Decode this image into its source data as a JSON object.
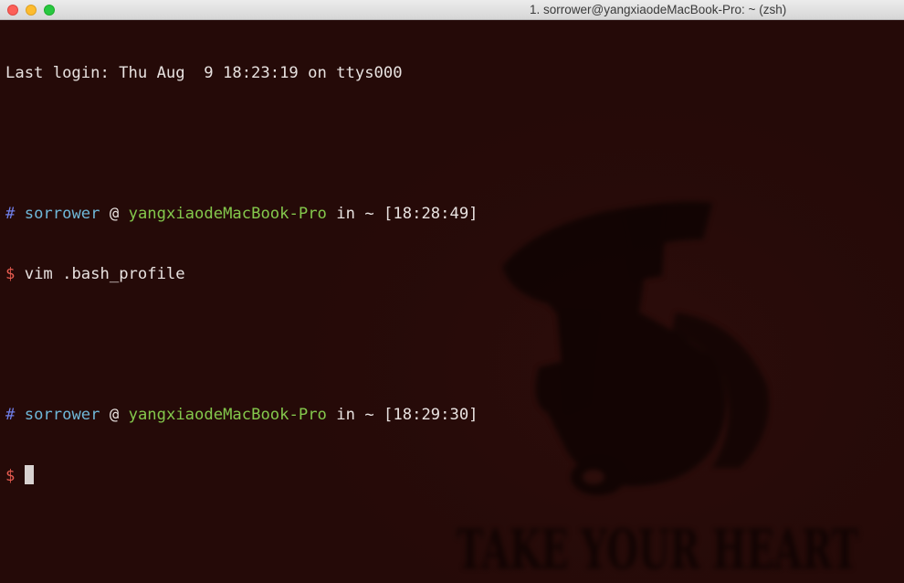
{
  "window": {
    "title": "1. sorrower@yangxiaodeMacBook-Pro: ~ (zsh)"
  },
  "terminal": {
    "last_login": "Last login: Thu Aug  9 18:23:19 on ttys000",
    "prompts": [
      {
        "hash": "#",
        "user": "sorrower",
        "at": "@",
        "host": "yangxiaodeMacBook-Pro",
        "in": "in",
        "dir": "~",
        "time": "[18:28:49]",
        "dollar": "$",
        "command": "vim .bash_profile"
      },
      {
        "hash": "#",
        "user": "sorrower",
        "at": "@",
        "host": "yangxiaodeMacBook-Pro",
        "in": "in",
        "dir": "~",
        "time": "[18:29:30]",
        "dollar": "$",
        "command": ""
      }
    ],
    "wallpaper_text": "TAKE YOUR HEART"
  },
  "colors": {
    "background": "#260b09",
    "hash": "#6f7fe8",
    "user": "#6fb7d8",
    "host": "#84c84c",
    "dollar": "#e85c50",
    "text": "#e8e2e0"
  }
}
